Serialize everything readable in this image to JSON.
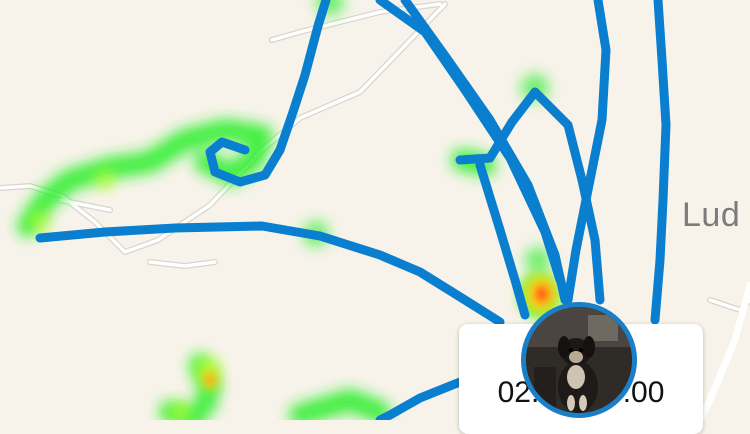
{
  "map": {
    "place_label": "Lud",
    "route_color": "#0a7fcf",
    "heat_colors": [
      "#00ff00",
      "#ffff00",
      "#ff0000"
    ],
    "road_color": "#ffffff"
  },
  "photo_marker": {
    "timestamp": "02.12.  13:00",
    "ring_color": "#1a7fc6",
    "image_subject": "dog"
  }
}
